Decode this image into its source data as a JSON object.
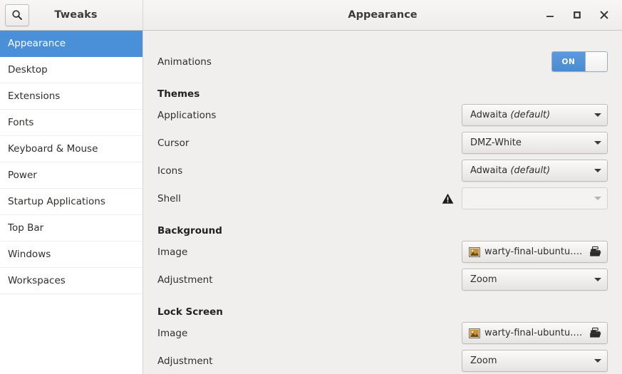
{
  "window": {
    "app_title": "Tweaks",
    "page_title": "Appearance",
    "search_icon": "search-icon",
    "controls": [
      {
        "name": "minimize-button",
        "icon": "minimize-icon"
      },
      {
        "name": "maximize-button",
        "icon": "maximize-icon"
      },
      {
        "name": "close-button",
        "icon": "close-icon"
      }
    ]
  },
  "sidebar": {
    "items": [
      {
        "label": "Appearance",
        "selected": true
      },
      {
        "label": "Desktop",
        "selected": false
      },
      {
        "label": "Extensions",
        "selected": false
      },
      {
        "label": "Fonts",
        "selected": false
      },
      {
        "label": "Keyboard & Mouse",
        "selected": false
      },
      {
        "label": "Power",
        "selected": false
      },
      {
        "label": "Startup Applications",
        "selected": false
      },
      {
        "label": "Top Bar",
        "selected": false
      },
      {
        "label": "Windows",
        "selected": false
      },
      {
        "label": "Workspaces",
        "selected": false
      }
    ]
  },
  "content": {
    "animations": {
      "label": "Animations",
      "switch_state": "ON",
      "switch_on": true
    },
    "themes": {
      "section_label": "Themes",
      "applications": {
        "label": "Applications",
        "value": "Adwaita",
        "value_suffix": "(default)",
        "disabled": false
      },
      "cursor": {
        "label": "Cursor",
        "value": "DMZ-White",
        "value_suffix": "",
        "disabled": false
      },
      "icons": {
        "label": "Icons",
        "value": "Adwaita",
        "value_suffix": "(default)",
        "disabled": false
      },
      "shell": {
        "label": "Shell",
        "value": "",
        "value_suffix": "",
        "disabled": true,
        "warning_icon": "warning-icon"
      }
    },
    "background": {
      "section_label": "Background",
      "image": {
        "label": "Image",
        "value": "warty-final-ubuntu.png",
        "thumb_icon": "image-thumbnail-icon",
        "open_icon": "open-folder-icon"
      },
      "adjustment": {
        "label": "Adjustment",
        "value": "Zoom"
      }
    },
    "lock_screen": {
      "section_label": "Lock Screen",
      "image": {
        "label": "Image",
        "value": "warty-final-ubuntu.png",
        "thumb_icon": "image-thumbnail-icon",
        "open_icon": "open-folder-icon"
      },
      "adjustment": {
        "label": "Adjustment",
        "value": "Zoom"
      }
    }
  },
  "colors": {
    "accent": "#4a90d9",
    "switch_on": "#5b9ade",
    "content_bg": "#f0efee",
    "sidebar_bg": "#ffffff",
    "header_bg": "#f4f3f2"
  }
}
